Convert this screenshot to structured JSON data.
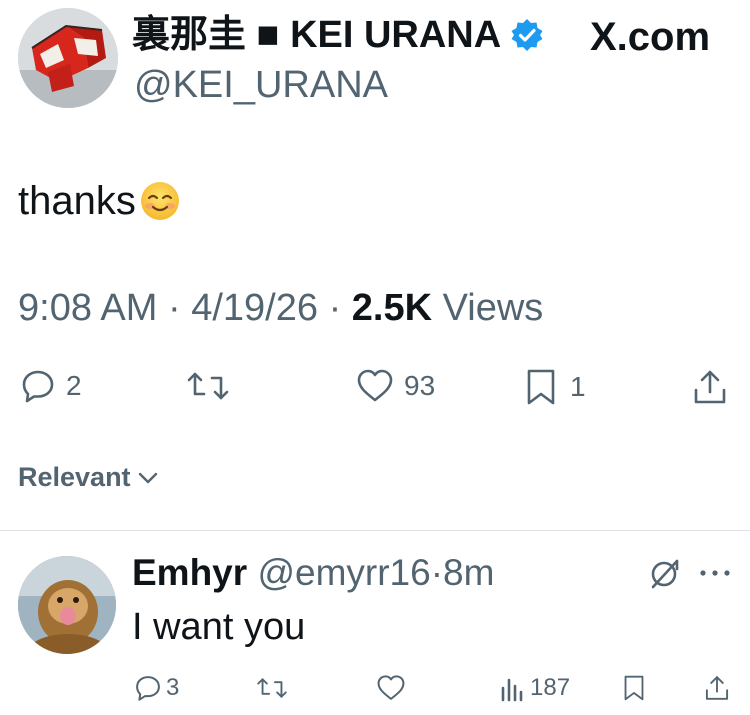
{
  "tweet": {
    "display_name": "裏那圭 ■ KEI URANA",
    "handle": "@KEI_URANA",
    "site": "X.com",
    "text": "thanks",
    "time": "9:08 AM",
    "date": "4/19/26",
    "views_count": "2.5K",
    "views_label": "Views",
    "separator": "·",
    "actions": {
      "replies": "2",
      "retweets": "",
      "likes": "93",
      "bookmarks": "1"
    }
  },
  "sort": {
    "label": "Relevant"
  },
  "reply": {
    "name": "Emhyr",
    "handle": "@emyrr16",
    "separator": "·",
    "age": "8m",
    "text": "I want you",
    "actions": {
      "replies": "3",
      "views": "187"
    }
  },
  "colors": {
    "text": "#0f1419",
    "muted": "#536471",
    "verified": "#1d9bf0",
    "divider": "#dfe3e6"
  },
  "icons": [
    "verified-badge-icon",
    "x-logo-icon",
    "smile-emoji-icon",
    "reply-icon",
    "retweet-icon",
    "like-icon",
    "bookmark-icon",
    "share-icon",
    "chevron-down-icon",
    "grok-icon",
    "more-icon",
    "views-icon"
  ]
}
